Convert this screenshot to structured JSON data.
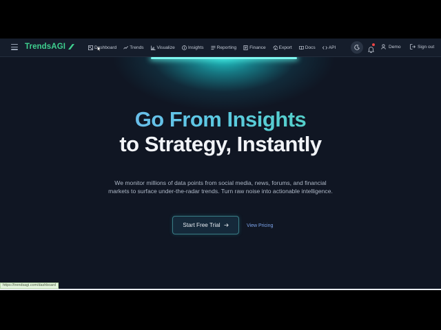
{
  "brand": {
    "name": "TrendsAGI",
    "color": "#3fd08f"
  },
  "nav": {
    "items": [
      {
        "label": "Dashboard",
        "icon": "dashboard-icon"
      },
      {
        "label": "Trends",
        "icon": "trends-icon"
      },
      {
        "label": "Visualize",
        "icon": "chart-icon"
      },
      {
        "label": "Insights",
        "icon": "insights-icon"
      },
      {
        "label": "Reporting",
        "icon": "reporting-icon"
      },
      {
        "label": "Finance",
        "icon": "finance-icon"
      },
      {
        "label": "Export",
        "icon": "export-icon"
      },
      {
        "label": "Docs",
        "icon": "docs-icon"
      },
      {
        "label": "API",
        "icon": "code-icon"
      }
    ],
    "user_label": "Demo",
    "sign_out_label": "Sign out"
  },
  "hero": {
    "title_line1": "Go From Insights",
    "title_line2": "to Strategy, Instantly",
    "subtitle": "We monitor millions of data points from social media, news, forums, and financial markets to surface under-the-radar trends. Turn raw noise into actionable intelligence.",
    "primary_cta": "Start Free Trial",
    "secondary_cta": "View Pricing"
  },
  "status_bar": {
    "url": "https://trendsagi.com/dashboard"
  },
  "colors": {
    "background": "#101623",
    "navbar": "#151d2b",
    "accent_cyan": "#22d3d2",
    "link": "#7ea6ee"
  }
}
